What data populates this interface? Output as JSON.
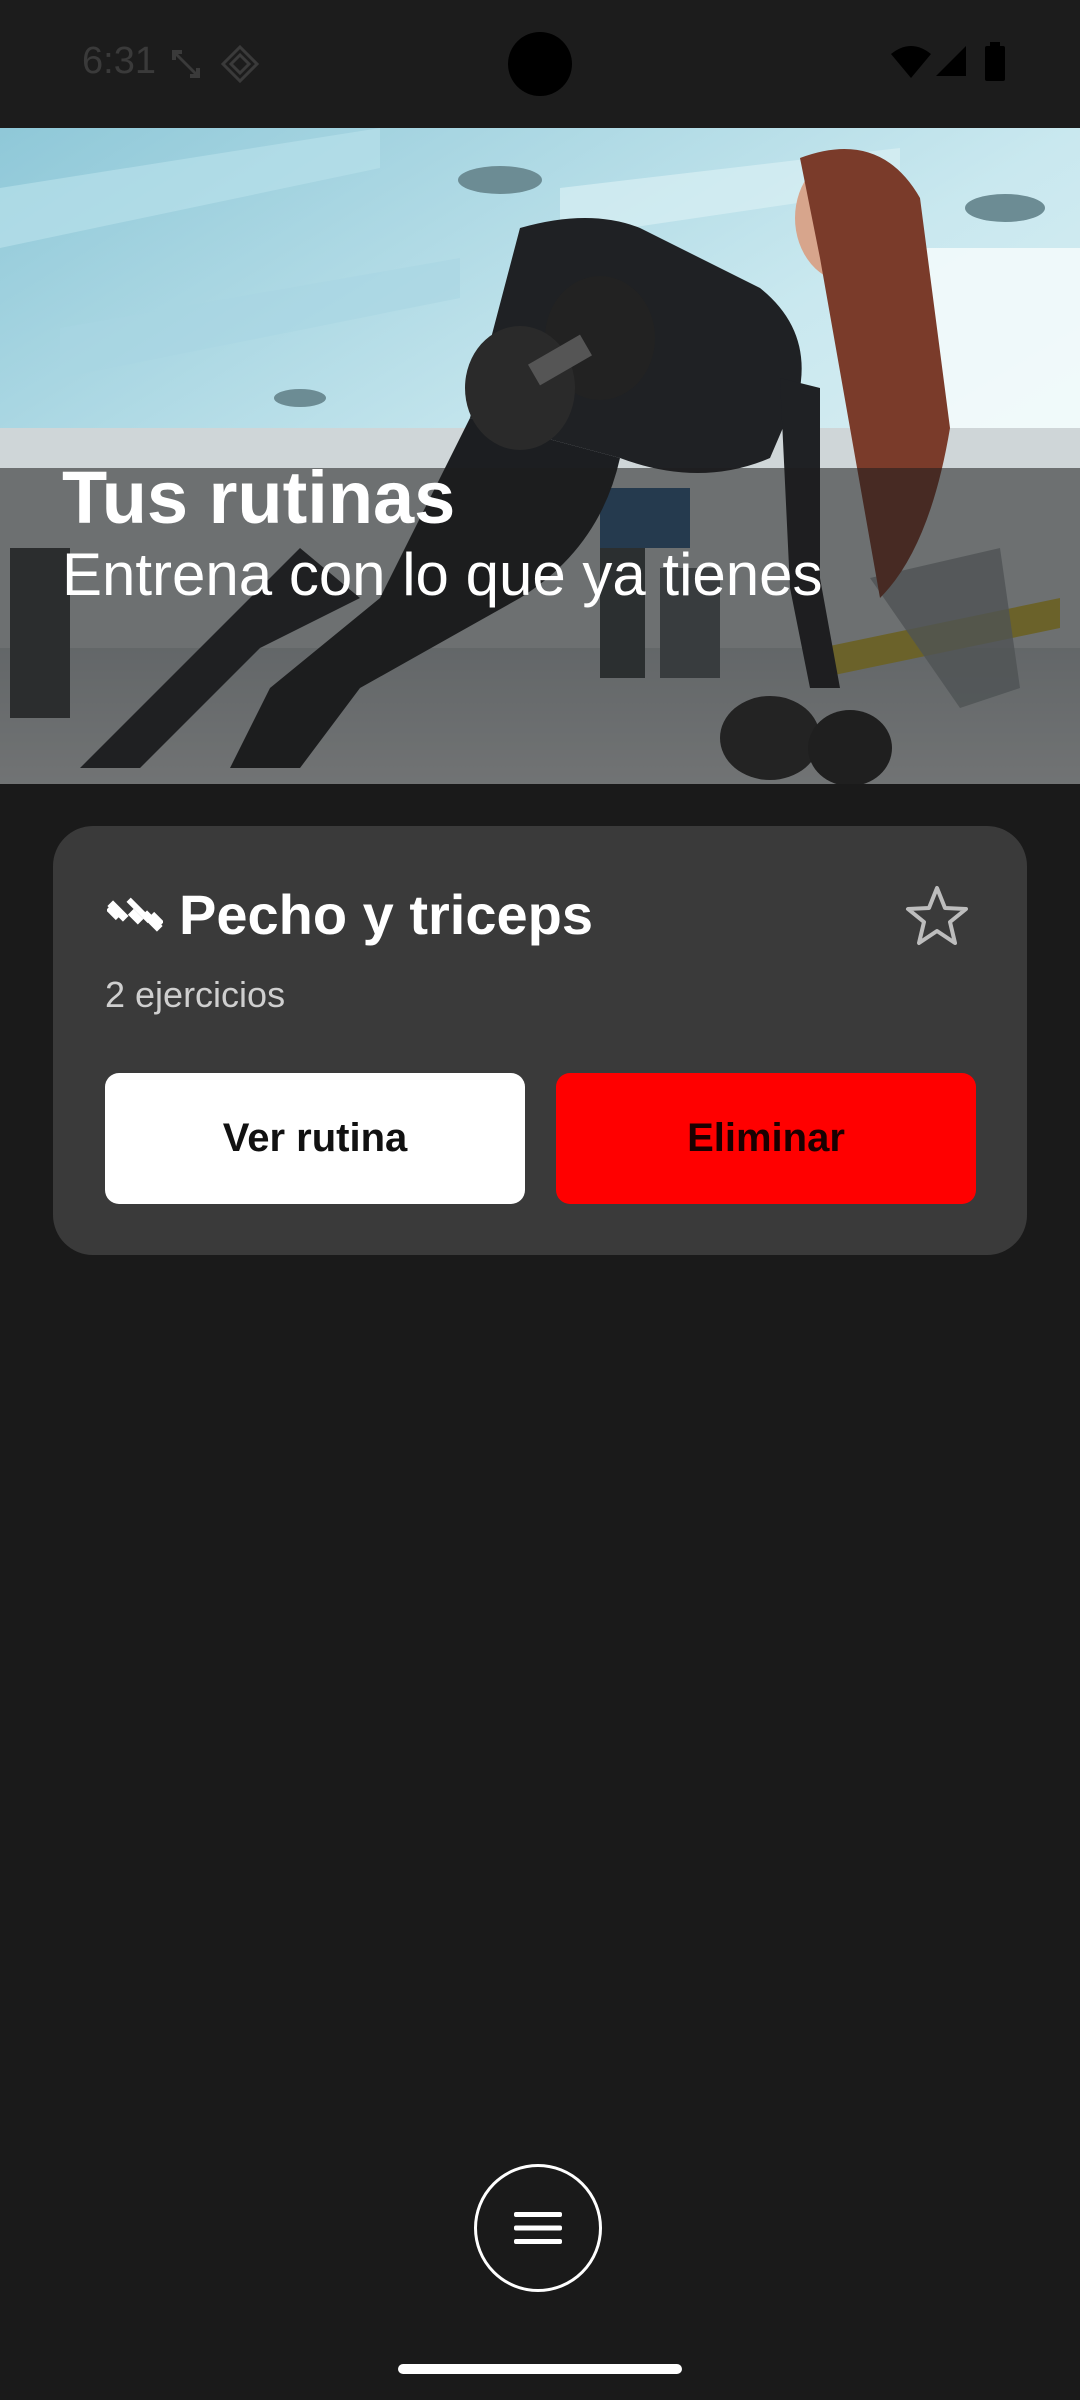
{
  "status_bar": {
    "time": "6:31",
    "icons_left": [
      "data-transfer-icon",
      "location-diamond-icon"
    ],
    "icons_right": [
      "wifi-icon",
      "cellular-signal-icon",
      "battery-icon"
    ]
  },
  "hero": {
    "title": "Tus rutinas",
    "subtitle": "Entrena con lo que ya tienes",
    "image": "gym-woman-dumbbell-photo"
  },
  "routines": [
    {
      "icon": "dumbbell-icon",
      "name": "Pecho y triceps",
      "count_label": "2 ejercicios",
      "favorite_icon": "star-outline-icon",
      "view_label": "Ver rutina",
      "delete_label": "Eliminar"
    }
  ],
  "fab": {
    "icon": "hamburger-menu-icon"
  },
  "colors": {
    "background": "#1a1a1a",
    "card": "#3a3a3a",
    "delete": "#ff0000",
    "primary_button": "#ffffff"
  }
}
